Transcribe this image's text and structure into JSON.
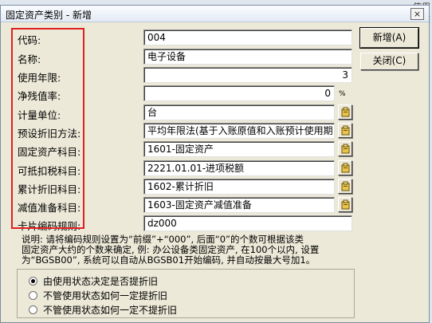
{
  "window": {
    "title": "固定资产类别 - 新增",
    "close_glyph": "×"
  },
  "background": {
    "peek_text": "使用状态"
  },
  "form": {
    "fields": [
      {
        "label": "代码:",
        "value": "004"
      },
      {
        "label": "名称:",
        "value": "电子设备"
      },
      {
        "label": "使用年限:",
        "value": "3"
      },
      {
        "label": "净残值率:",
        "value": "0",
        "unit": "%"
      },
      {
        "label": "计量单位:",
        "value": "台"
      },
      {
        "label": "预设折旧方法:",
        "value": "平均年限法(基于入账原值和入账预计使用期"
      },
      {
        "label": "固定资产科目:",
        "value": "1601-固定资产"
      },
      {
        "label": "可抵扣税科目:",
        "value": "2221.01.01-进项税额"
      },
      {
        "label": "累计折旧科目:",
        "value": "1602-累计折旧"
      },
      {
        "label": "减值准备科目:",
        "value": "1603-固定资产减值准备"
      },
      {
        "label": "卡片编码规则:",
        "value": "dz000"
      }
    ]
  },
  "buttons": {
    "new": "新增(A)",
    "close": "关闭(C)"
  },
  "description": {
    "line1": "说明: 请将编码规则设置为“前缀”+“000”, 后面“0”的个数可根据该类",
    "line2": "固定资产大约的个数来确定, 例: 办公设备类固定资产, 在100个以内, 设置",
    "line3": "为“BGSB00”, 系统可以自动从BGSB01开始编码, 并自动按最大号加1。"
  },
  "depreciation_options": [
    {
      "label": "由使用状态决定是否提折旧",
      "selected": true
    },
    {
      "label": "不管使用状态如何一定提折旧",
      "selected": false
    },
    {
      "label": "不管使用状态如何一定不提折旧",
      "selected": false
    }
  ],
  "colors": {
    "highlight_border": "#e02020",
    "dialog_bg": "#ece9d8"
  },
  "icons": {
    "picker": "folder-picker-icon"
  }
}
